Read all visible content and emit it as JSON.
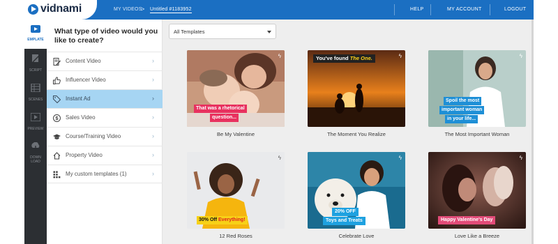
{
  "app": {
    "logo_text": "vidnami"
  },
  "header": {
    "breadcrumb": {
      "root": "MY VIDEOS",
      "separator": ">",
      "current": "Untitled #1183952"
    },
    "nav": {
      "help": "HELP",
      "account": "MY ACCOUNT",
      "logout": "LOGOUT"
    }
  },
  "rail": {
    "items": [
      {
        "label": "EMPLATE",
        "icon": "template-icon",
        "active": true
      },
      {
        "label": "SCRIPT",
        "icon": "script-icon",
        "active": false
      },
      {
        "label": "SCENES",
        "icon": "scenes-icon",
        "active": false
      },
      {
        "label": "PREVIEW",
        "icon": "preview-icon",
        "active": false
      },
      {
        "label": "DOWN LOAD",
        "icon": "download-icon",
        "active": false
      }
    ]
  },
  "panel": {
    "question": "What type of video would you like to create?",
    "categories": [
      {
        "label": "Content Video",
        "icon": "document-icon",
        "active": false
      },
      {
        "label": "Influencer Video",
        "icon": "thumbs-up-icon",
        "active": false
      },
      {
        "label": "Instant Ad",
        "icon": "tag-icon",
        "active": true
      },
      {
        "label": "Sales Video",
        "icon": "dollar-icon",
        "active": false
      },
      {
        "label": "Course/Training Video",
        "icon": "graduation-cap-icon",
        "active": false
      },
      {
        "label": "Property Video",
        "icon": "house-icon",
        "active": false
      },
      {
        "label": "My custom templates (1)",
        "icon": "grid-icon",
        "active": false
      }
    ]
  },
  "filter": {
    "selected": "All Templates"
  },
  "templates": [
    {
      "title": "Be My Valentine",
      "caption_lines": [
        "That was a rhetorical",
        "question..."
      ],
      "caption_bg": "#e8315f"
    },
    {
      "title": "The Moment You Realize",
      "caption_plain": "You've found ",
      "caption_highlight": "The One.",
      "caption_bg": "#222222",
      "highlight_color": "#ffd21a"
    },
    {
      "title": "The Most Important Woman",
      "caption_lines": [
        "Spoil the most",
        "important woman",
        "in your life..."
      ],
      "caption_bg": "#1e8fd6"
    },
    {
      "title": "12 Red Roses",
      "caption_plain": "30% Off ",
      "caption_highlight": "Everything!",
      "caption_bg": "#f7d117",
      "highlight_color": "#e02020"
    },
    {
      "title": "Celebrate Love",
      "caption_lines": [
        "20% OFF",
        "Toys and Treats"
      ],
      "caption_bg": "#1ea1e0"
    },
    {
      "title": "Love Like a Breeze",
      "caption_plain": "Happy Valentine's Day",
      "caption_bg": "#e24b78"
    }
  ],
  "colors": {
    "brand": "#1b6fc2",
    "active_category": "#a6d5f3",
    "rail": "#2c2f33"
  }
}
